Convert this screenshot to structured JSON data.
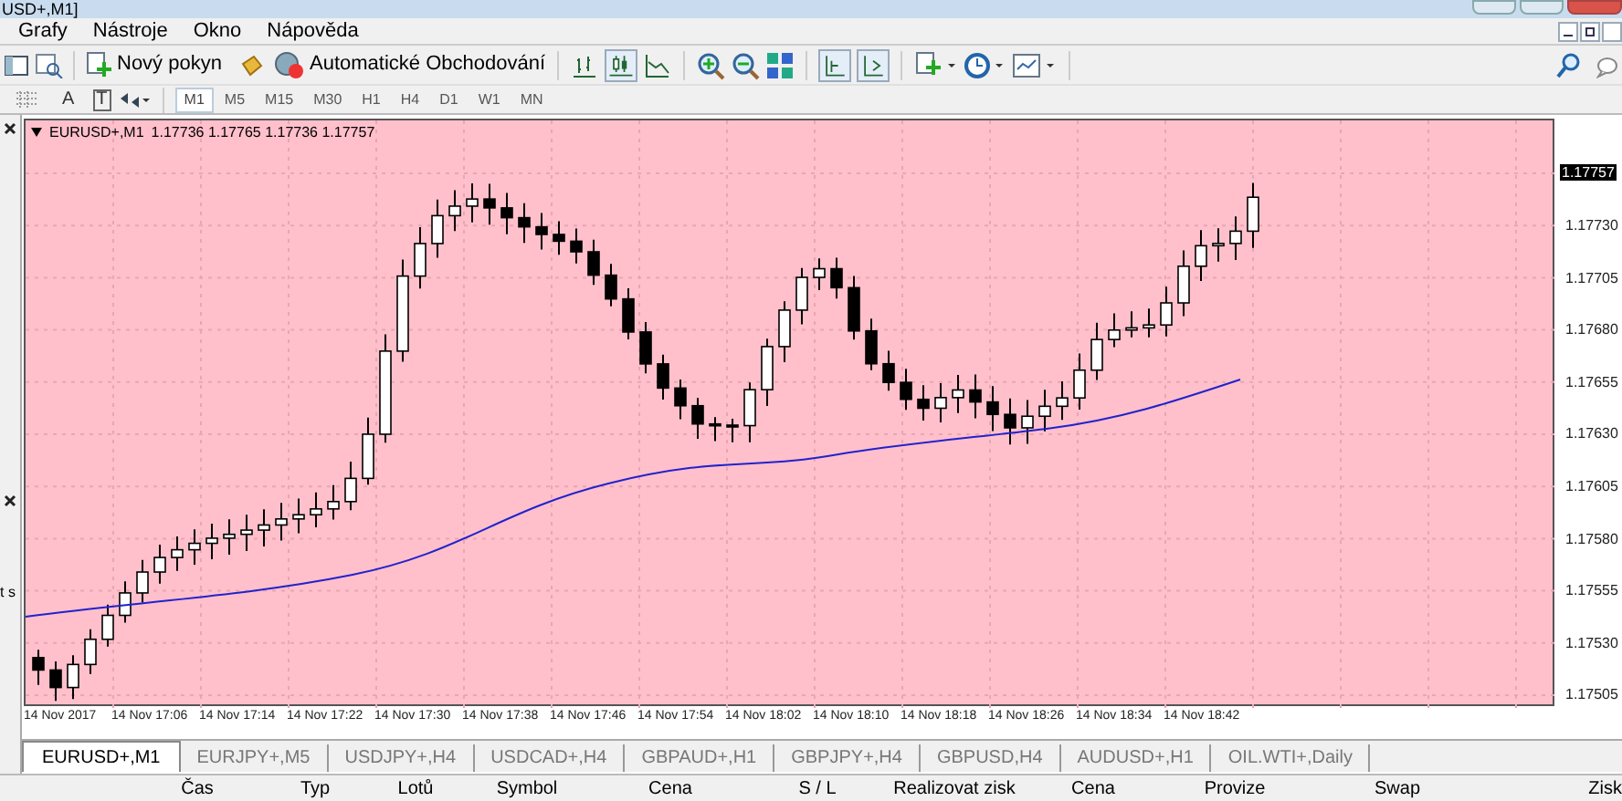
{
  "window": {
    "title": "USD+,M1]"
  },
  "menu": [
    "Grafy",
    "Nástroje",
    "Okno",
    "Nápověda"
  ],
  "toolbar": {
    "new_order": "Nový pokyn",
    "auto_trading": "Automatické Obchodování"
  },
  "drawing_tools": [
    {
      "label": "A"
    },
    {
      "label": "T"
    }
  ],
  "timeframes": [
    {
      "label": "M1",
      "selected": true
    },
    {
      "label": "M5",
      "selected": false
    },
    {
      "label": "M15",
      "selected": false
    },
    {
      "label": "M30",
      "selected": false
    },
    {
      "label": "H1",
      "selected": false
    },
    {
      "label": "H4",
      "selected": false
    },
    {
      "label": "D1",
      "selected": false
    },
    {
      "label": "W1",
      "selected": false
    },
    {
      "label": "MN",
      "selected": false
    }
  ],
  "left_panel": {
    "text": "t s"
  },
  "chart": {
    "symbol": "EURUSD+,M1",
    "ohlc": "1.17736 1.17765 1.17736 1.17757",
    "current_price": "1.17757",
    "price_labels": [
      "1.17730",
      "1.17705",
      "1.17680",
      "1.17655",
      "1.17630",
      "1.17605",
      "1.17580",
      "1.17555",
      "1.17530",
      "1.17505"
    ],
    "time_labels": [
      "14 Nov 2017",
      "14 Nov 17:06",
      "14 Nov 17:14",
      "14 Nov 17:22",
      "14 Nov 17:30",
      "14 Nov 17:38",
      "14 Nov 17:46",
      "14 Nov 17:54",
      "14 Nov 18:02",
      "14 Nov 18:10",
      "14 Nov 18:18",
      "14 Nov 18:26",
      "14 Nov 18:34",
      "14 Nov 18:42"
    ]
  },
  "chart_tabs": [
    {
      "label": "EURUSD+,M1",
      "selected": true
    },
    {
      "label": "EURJPY+,M5",
      "selected": false
    },
    {
      "label": "USDJPY+,H4",
      "selected": false
    },
    {
      "label": "USDCAD+,H4",
      "selected": false
    },
    {
      "label": "GBPAUD+,H1",
      "selected": false
    },
    {
      "label": "GBPJPY+,H4",
      "selected": false
    },
    {
      "label": "GBPUSD,H4",
      "selected": false
    },
    {
      "label": "AUDUSD+,H1",
      "selected": false
    },
    {
      "label": "OIL.WTI+,Daily",
      "selected": false
    }
  ],
  "terminal_columns": [
    "Čas",
    "Typ",
    "Lotů",
    "Symbol",
    "Cena",
    "S / L",
    "Realizovat zisk",
    "Cena",
    "Provize",
    "Swap",
    "Zisk"
  ]
}
